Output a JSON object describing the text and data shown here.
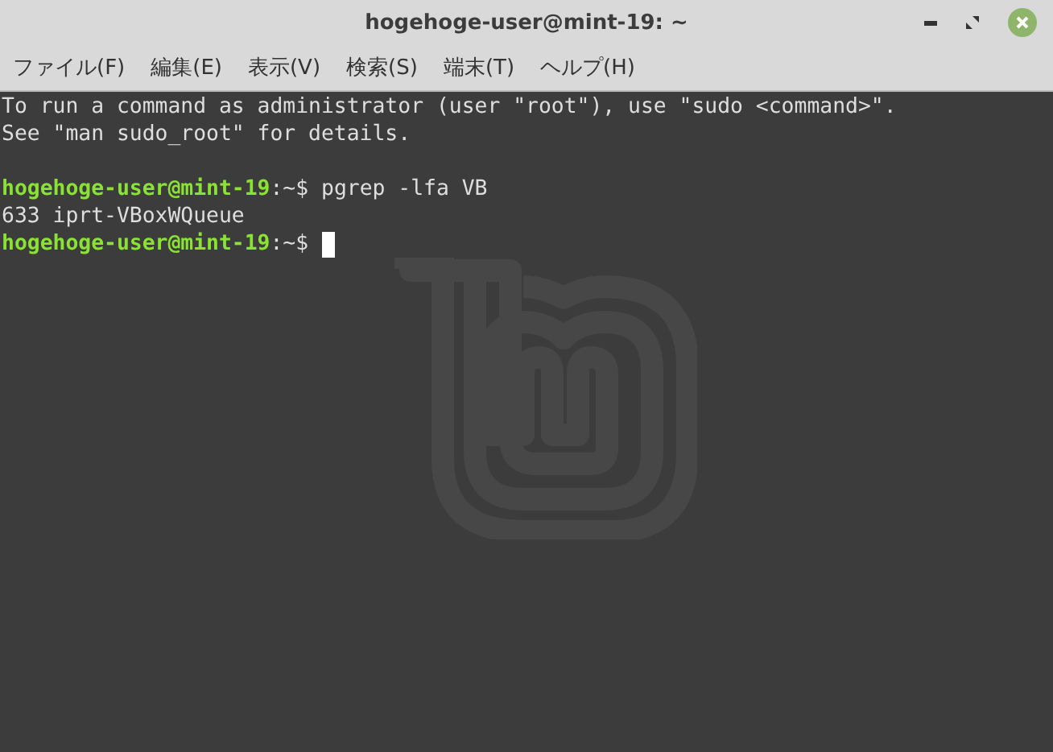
{
  "window": {
    "title": "hogehoge-user@mint-19: ~"
  },
  "menu": [
    "ファイル(F)",
    "編集(E)",
    "表示(V)",
    "検索(S)",
    "端末(T)",
    "ヘルプ(H)"
  ],
  "terminal": {
    "lines": [
      {
        "kind": "output",
        "text": "To run a command as administrator (user \"root\"), use \"sudo <command>\"."
      },
      {
        "kind": "output",
        "text": "See \"man sudo_root\" for details."
      },
      {
        "kind": "blank"
      },
      {
        "kind": "prompt",
        "user_host": "hogehoge-user@mint-19",
        "path": ":~",
        "symbol": "$",
        "command": "pgrep -lfa VB",
        "cursor": false
      },
      {
        "kind": "output",
        "text": "633 iprt-VBoxWQueue"
      },
      {
        "kind": "prompt",
        "user_host": "hogehoge-user@mint-19",
        "path": ":~",
        "symbol": "$",
        "cursor": true
      }
    ]
  }
}
